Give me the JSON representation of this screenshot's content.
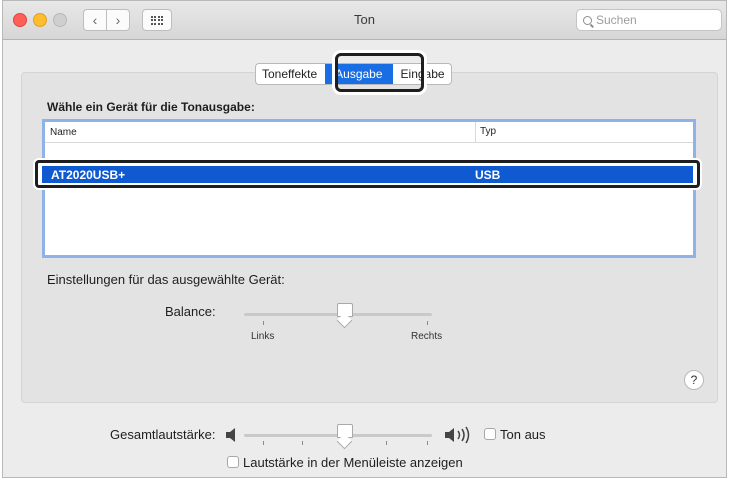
{
  "window": {
    "title": "Ton"
  },
  "search": {
    "placeholder": "Suchen"
  },
  "tabs": [
    {
      "label": "Toneffekte",
      "selected": false
    },
    {
      "label": "Ausgabe",
      "selected": true
    },
    {
      "label": "Eingabe",
      "selected": false
    }
  ],
  "output": {
    "heading": "Wähle ein Gerät für die Tonausgabe:",
    "columns": [
      "Name",
      "Typ"
    ],
    "devices": [
      {
        "name": "AT2020USB+",
        "type": "USB",
        "selected": true
      }
    ]
  },
  "settings": {
    "heading": "Einstellungen für das ausgewählte Gerät:",
    "balance_label": "Balance:",
    "balance_left": "Links",
    "balance_right": "Rechts",
    "balance_value": 0.5,
    "help": "?"
  },
  "volume": {
    "label": "Gesamtlautstärke:",
    "value": 0.5,
    "mute_label": "Ton aus",
    "mute_checked": false,
    "menubar_label": "Lautstärke in der Menüleiste anzeigen",
    "menubar_checked": false
  },
  "colors": {
    "accent": "#1a6ee3",
    "selection": "#0f5ad1"
  }
}
